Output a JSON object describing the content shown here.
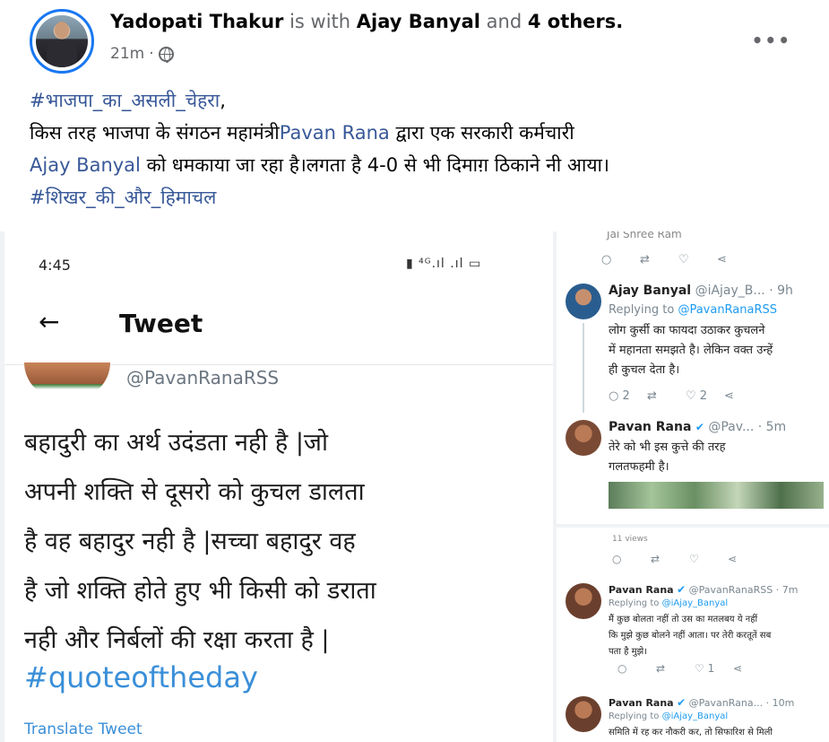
{
  "post": {
    "author": "Yadopati Thakur",
    "with_text": "is with",
    "tagged": "Ajay Banyal",
    "and_text": "and",
    "others": "4 others.",
    "time": "21m",
    "dot": "·",
    "more": "•••",
    "hashtag1": "#भाजपा_का_असली_चेहरा",
    "comma": ",",
    "line2_a": "किस तरह भाजपा के संगठन महामंत्री",
    "mention1": "Pavan Rana",
    "line2_b": " द्वारा एक सरकारी कर्मचारी",
    "mention2": "Ajay Banyal",
    "line3": " को धमकाया जा रहा है।लगता है 4-0 से भी दिमाग़ ठिकाने नी आया।",
    "hashtag2": "#शिखर_की_और_हिमाचल"
  },
  "left_image": {
    "time": "4:45",
    "status_icons": "\u0000",
    "back": "←",
    "title": "Tweet",
    "handle": "@PavanRanaRSS",
    "body_lines": [
      "बहादुरी का अर्थ उदंडता नही है |जो",
      "अपनी शक्ति से दूसरो को कुचल डालता",
      "है वह बहादुर नही है |सच्चा बहादुर वह",
      "है जो शक्ति होते हुए भी किसी को डराता",
      "नही और निर्बलों की रक्षा करता है |"
    ],
    "hashtag": "#quoteoftheday",
    "translate": "Translate Tweet"
  },
  "right_top": {
    "cut_text": "Jai Shree Ram",
    "reply1": {
      "name": "Ajay Banyal",
      "handle_time": "@iAjay_B... · 9h",
      "replying_label": "Replying to",
      "replying_to": "@PavanRanaRSS",
      "lines": [
        "लोग कुर्सी का फायदा उठाकर कुचलने",
        "में महानता समझते है। लेकिन वक्त उन्हें",
        "ही कुचल देता है।"
      ],
      "replies": "2",
      "likes": "2"
    },
    "reply2": {
      "name": "Pavan Rana",
      "handle_time": "@Pav... · 5m",
      "lines": [
        "तेरे को भी इस कुत्ते की तरह",
        "गलतफहमी है।"
      ]
    }
  },
  "right_bottom": {
    "views": "11 views",
    "reply3": {
      "name": "Pavan Rana",
      "handle_time": "@PavanRanaRSS · 7m",
      "replying_label": "Replying to",
      "replying_to": "@iAjay_Banyal",
      "lines": [
        "मैं कुछ बोलता नहीं तो उस का मतलबय ये नहीं",
        "कि मुझे कुछ बोलने नहीं आता। पर तेरी करतूतें सब",
        "पता है मुझे।"
      ],
      "likes": "1"
    },
    "reply4": {
      "name": "Pavan Rana",
      "handle_time": "@PavanRana... · 10m",
      "replying_label": "Replying to",
      "replying_to": "@iAjay_Banyal",
      "lines": [
        "समिति में रह कर नौकरी कर, तो सिफारिश से मिली"
      ]
    }
  },
  "colors": {
    "fb_blue": "#1877f2",
    "link": "#385898",
    "twitter_blue": "#1d9bf0"
  }
}
